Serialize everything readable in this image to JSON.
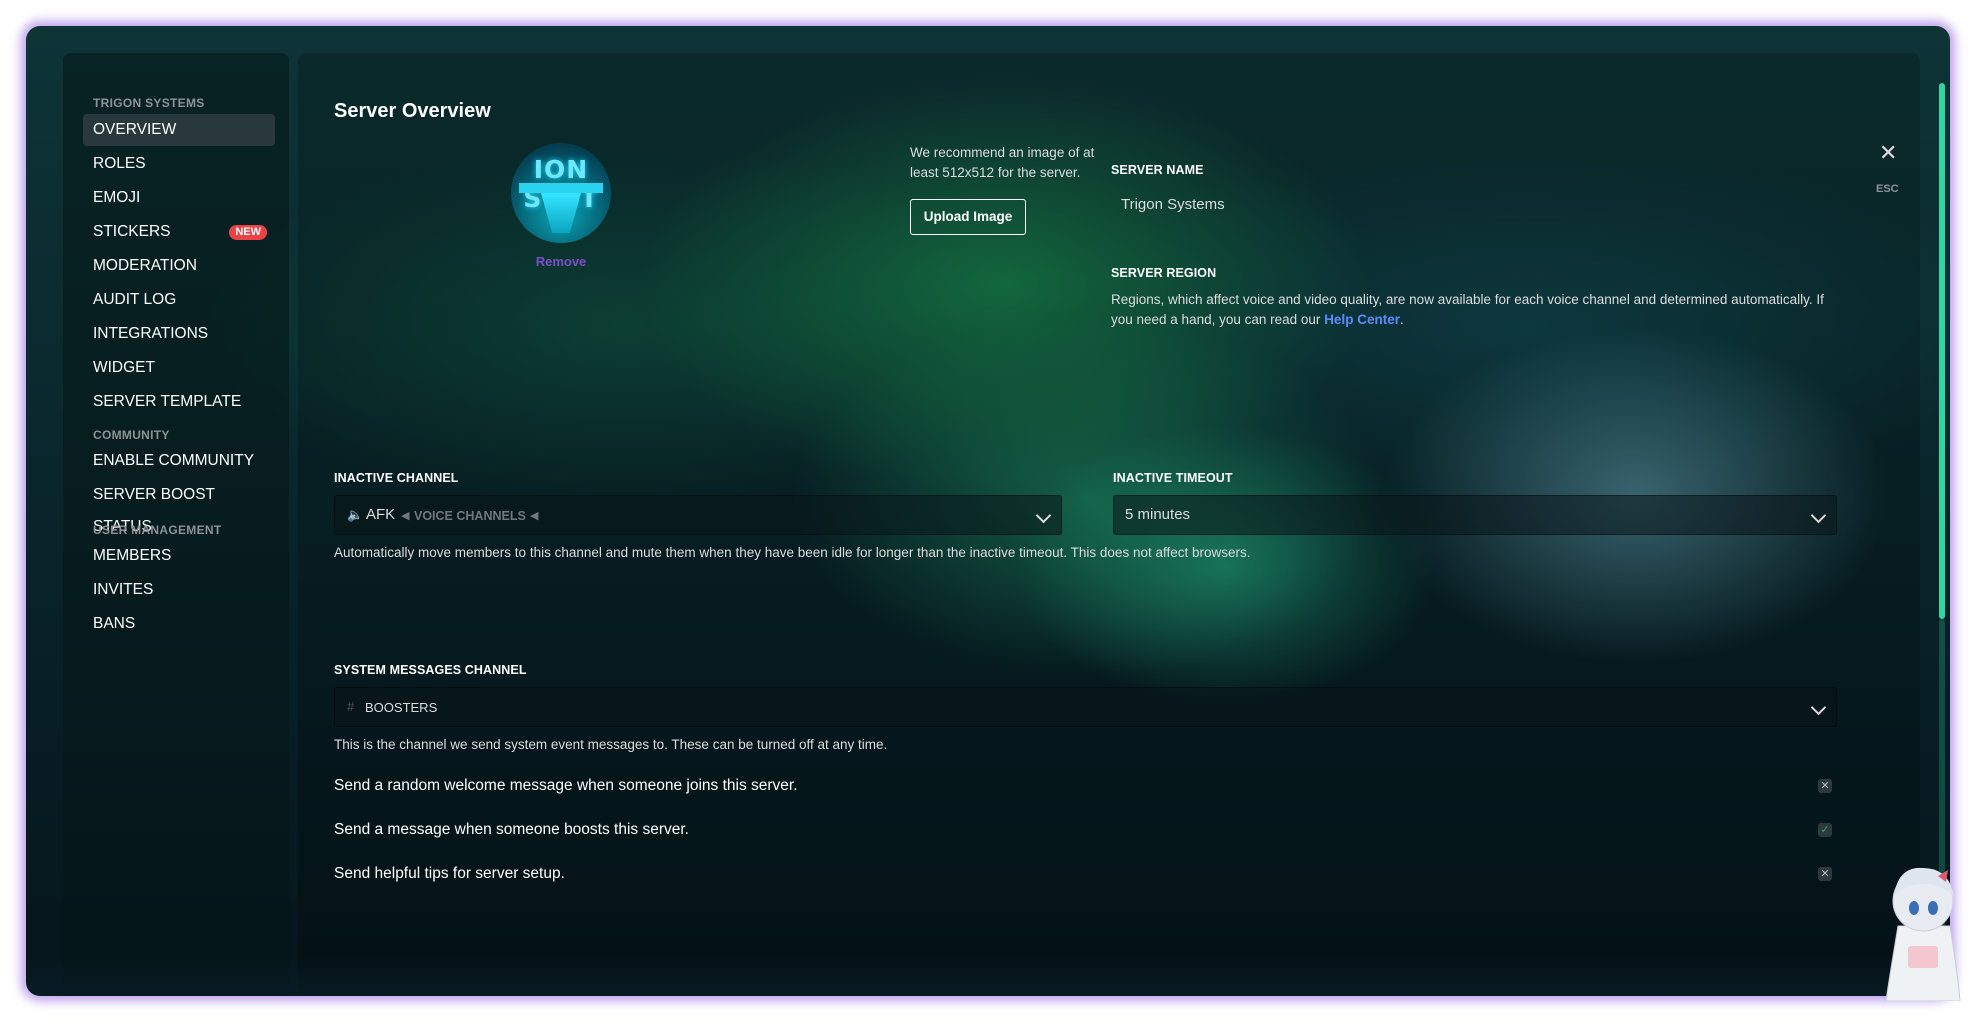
{
  "sidebar": {
    "server_name": "TRIGON SYSTEMS",
    "community_header": "COMMUNITY",
    "user_management_header": "USER MANAGEMENT",
    "items": [
      {
        "label": "OVERVIEW"
      },
      {
        "label": "ROLES"
      },
      {
        "label": "EMOJI"
      },
      {
        "label": "STICKERS",
        "badge": "NEW"
      },
      {
        "label": "MODERATION"
      },
      {
        "label": "AUDIT LOG"
      },
      {
        "label": "INTEGRATIONS"
      },
      {
        "label": "WIDGET"
      },
      {
        "label": "SERVER TEMPLATE"
      },
      {
        "label": "ENABLE COMMUNITY"
      },
      {
        "label": "SERVER BOOST STATUS"
      },
      {
        "label": "MEMBERS"
      },
      {
        "label": "INVITES"
      },
      {
        "label": "BANS"
      }
    ]
  },
  "main": {
    "title": "Server Overview",
    "icon_text": "ION SYST",
    "remove_label": "Remove",
    "upload_hint": "We recommend an image of at least 512x512 for the server.",
    "upload_button": "Upload Image",
    "server_name_label": "SERVER NAME",
    "server_name_value": "Trigon Systems",
    "server_region_label": "SERVER REGION",
    "server_region_text": "Regions, which affect voice and video quality, are now available for each voice channel and determined automatically. If you need a hand, you can read our",
    "help_link": "Help Center",
    "inactive_channel_label": "INACTIVE CHANNEL",
    "inactive_channel_value": "AFK",
    "inactive_channel_category": "VOICE CHANNELS",
    "inactive_timeout_label": "INACTIVE TIMEOUT",
    "inactive_timeout_value": "5 minutes",
    "inactive_help": "Automatically move members to this channel and mute them when they have been idle for longer than the inactive timeout. This does not affect browsers.",
    "system_channel_label": "SYSTEM MESSAGES CHANNEL",
    "system_channel_value": "BOOSTERS",
    "system_channel_help": "This is the channel we send system event messages to. These can be turned off at any time.",
    "options": [
      {
        "label": "Send a random welcome message when someone joins this server.",
        "enabled": false
      },
      {
        "label": "Send a message when someone boosts this server.",
        "enabled": true
      },
      {
        "label": "Send helpful tips for server setup.",
        "enabled": false
      }
    ],
    "close_label": "ESC"
  },
  "colors": {
    "accent_link": "#5a8cff",
    "badge_red": "#ed4245",
    "scrollbar": "#2fd6a4",
    "window_glow": "#aa82e6"
  }
}
